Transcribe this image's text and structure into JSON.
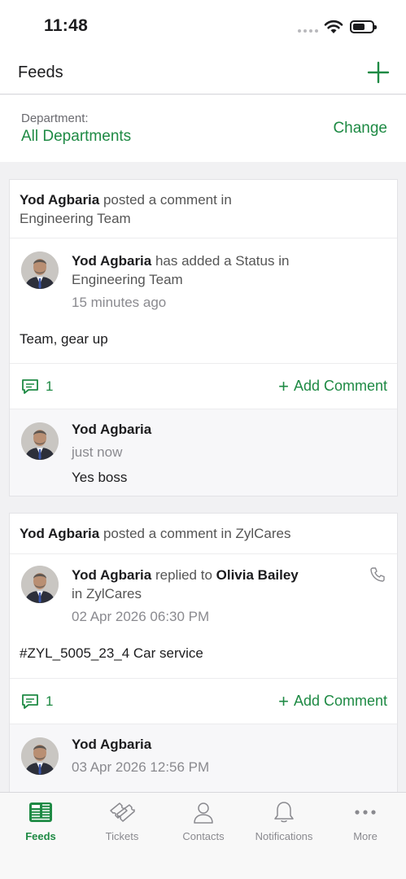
{
  "status_bar": {
    "time": "11:48"
  },
  "header": {
    "title": "Feeds"
  },
  "department": {
    "label": "Department:",
    "value": "All Departments",
    "change_label": "Change"
  },
  "feeds": [
    {
      "header_name": "Yod Agbaria",
      "header_text": "posted a comment in",
      "header_target": "Engineering Team",
      "post": {
        "author": "Yod Agbaria",
        "action": "has added a Status in",
        "target": "Engineering Team",
        "time": "15 minutes ago",
        "body": "Team, gear up"
      },
      "comment_count": "1",
      "add_comment_label": "Add Comment",
      "comment": {
        "author": "Yod Agbaria",
        "time": "just now",
        "text": "Yes boss"
      }
    },
    {
      "header_name": "Yod Agbaria",
      "header_text": "posted a comment in ZylCares",
      "post": {
        "author": "Yod Agbaria",
        "action": "replied to",
        "reply_to": "Olivia Bailey",
        "target": "in ZylCares",
        "time": "02 Apr 2026 06:30 PM",
        "body": "#ZYL_5005_23_4 Car service"
      },
      "comment_count": "1",
      "add_comment_label": "Add Comment",
      "comment": {
        "author": "Yod Agbaria",
        "time": "03 Apr 2026 12:56 PM"
      }
    }
  ],
  "tabs": [
    {
      "label": "Feeds",
      "icon": "feeds-icon",
      "active": true
    },
    {
      "label": "Tickets",
      "icon": "tickets-icon",
      "active": false
    },
    {
      "label": "Contacts",
      "icon": "contacts-icon",
      "active": false
    },
    {
      "label": "Notifications",
      "icon": "bell-icon",
      "active": false
    },
    {
      "label": "More",
      "icon": "more-icon",
      "active": false
    }
  ],
  "colors": {
    "accent": "#1e8a44",
    "muted": "#8a8a8f",
    "background": "#f1f1f3"
  }
}
